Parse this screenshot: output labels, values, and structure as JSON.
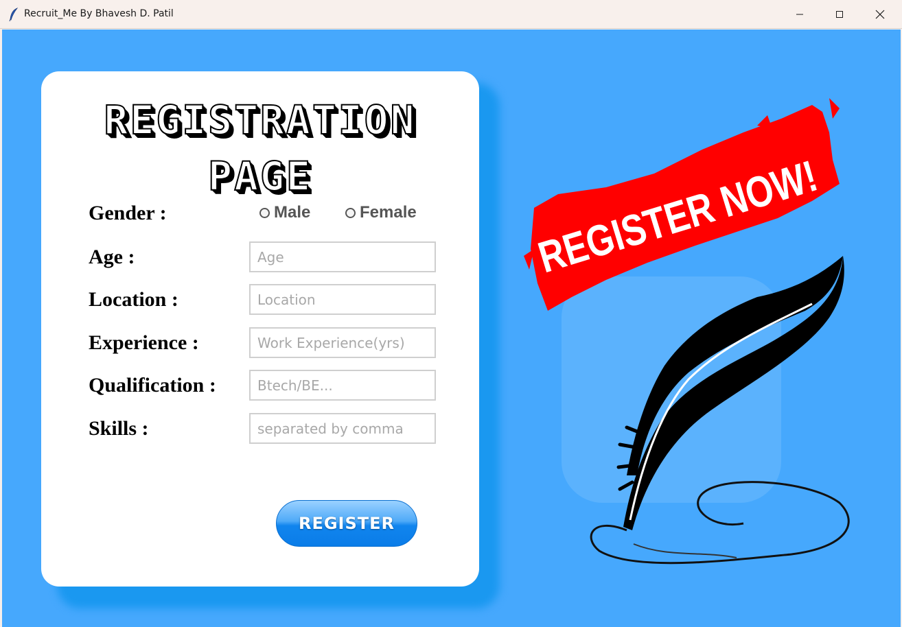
{
  "window": {
    "title": "Recruit_Me By Bhavesh D. Patil"
  },
  "heading": {
    "line1": "REGISTRATION",
    "line2": "PAGE"
  },
  "form": {
    "gender_label": "Gender :",
    "gender_options": [
      "Male",
      "Female"
    ],
    "age_label": "Age :",
    "age_placeholder": "Age",
    "location_label": "Location :",
    "location_placeholder": "Location",
    "experience_label": "Experience :",
    "experience_placeholder": "Work Experience(yrs)",
    "qualification_label": "Qualification :",
    "qualification_placeholder": "Btech/BE...",
    "skills_label": "Skills :",
    "skills_placeholder": "separated by comma",
    "register_label": "REGISTER"
  },
  "banner": {
    "text": "REGISTER NOW!"
  },
  "colors": {
    "background": "#46a8fd",
    "card": "#ffffff",
    "banner_red": "#ff0000",
    "button_blue": "#1185ee"
  },
  "icons": [
    "feather-icon",
    "minimize-icon",
    "maximize-icon",
    "close-icon",
    "quill-pen-icon"
  ]
}
